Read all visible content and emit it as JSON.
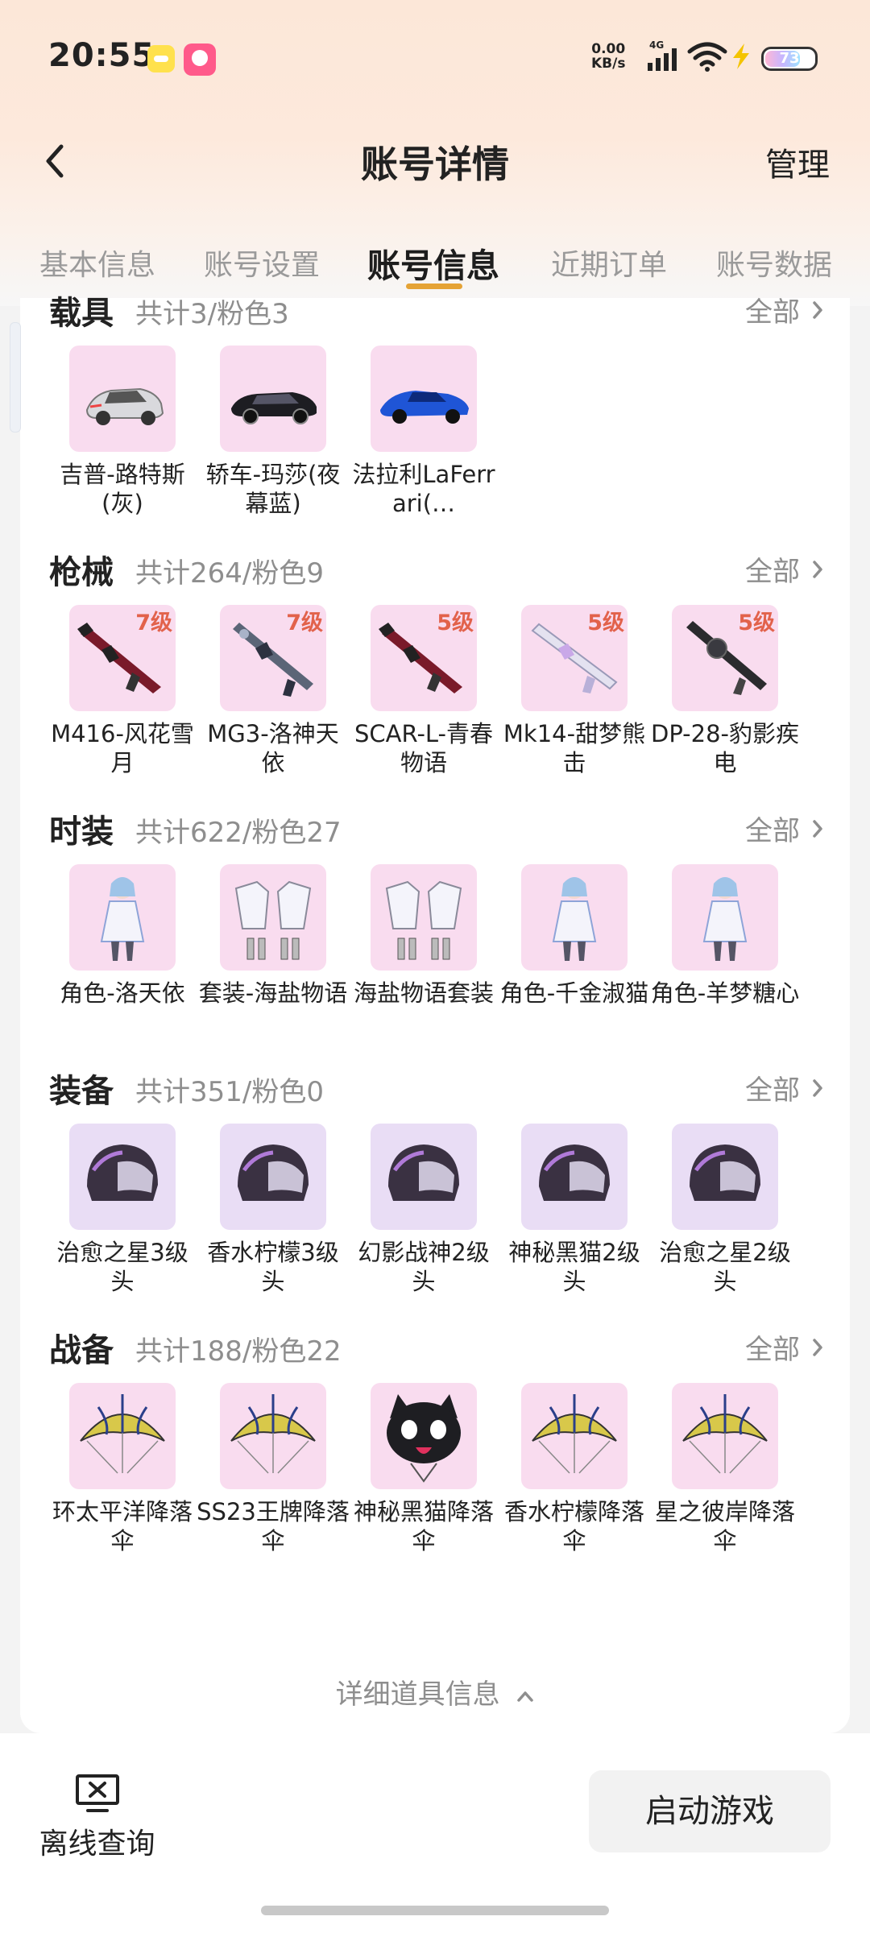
{
  "status_bar": {
    "time": "20:55",
    "net_speed_value": "0.00",
    "net_speed_unit": "KB/s",
    "network_type": "4G",
    "battery_level": "73"
  },
  "nav": {
    "title": "账号详情",
    "manage_label": "管理"
  },
  "tabs": [
    {
      "label": "基本信息",
      "active": false
    },
    {
      "label": "账号设置",
      "active": false
    },
    {
      "label": "账号信息",
      "active": true
    },
    {
      "label": "近期订单",
      "active": false
    },
    {
      "label": "账号数据",
      "active": false
    }
  ],
  "sections": [
    {
      "title": "载具",
      "count": "共计3/粉色3",
      "all_label": "全部",
      "items": [
        {
          "label": "吉普-路特斯(灰)",
          "icon": "gray-suv-icon"
        },
        {
          "label": "轿车-玛莎(夜幕蓝)",
          "icon": "black-sedan-icon"
        },
        {
          "label": "法拉利LaFerrari(…",
          "icon": "blue-supercar-icon"
        }
      ]
    },
    {
      "title": "枪械",
      "count": "共计264/粉色9",
      "all_label": "全部",
      "items": [
        {
          "label": "M416-风花雪月",
          "level": "7级",
          "icon": "rifle-icon"
        },
        {
          "label": "MG3-洛神天依",
          "level": "7级",
          "icon": "machine-gun-icon"
        },
        {
          "label": "SCAR-L-青春物语",
          "level": "5级",
          "icon": "rifle-icon"
        },
        {
          "label": "Mk14-甜梦熊击",
          "level": "5级",
          "icon": "marksman-rifle-icon"
        },
        {
          "label": "DP-28-豹影疾电",
          "level": "5级",
          "icon": "light-machine-gun-icon"
        }
      ]
    },
    {
      "title": "时装",
      "count": "共计622/粉色27",
      "all_label": "全部",
      "items": [
        {
          "label": "角色-洛天依",
          "icon": "character-icon"
        },
        {
          "label": "套装-海盐物语",
          "icon": "outfit-set-icon"
        },
        {
          "label": "海盐物语套装",
          "icon": "outfit-set-icon"
        },
        {
          "label": "角色-千金淑猫",
          "icon": "character-icon"
        },
        {
          "label": "角色-羊梦糖心",
          "icon": "character-icon"
        }
      ]
    },
    {
      "title": "装备",
      "count": "共计351/粉色0",
      "all_label": "全部",
      "items": [
        {
          "label": "治愈之星3级头",
          "icon": "helmet-icon"
        },
        {
          "label": "香水柠檬3级头",
          "icon": "helmet-icon"
        },
        {
          "label": "幻影战神2级头",
          "icon": "helmet-icon"
        },
        {
          "label": "神秘黑猫2级头",
          "icon": "helmet-icon"
        },
        {
          "label": "治愈之星2级头",
          "icon": "helmet-icon"
        }
      ]
    },
    {
      "title": "战备",
      "count": "共计188/粉色22",
      "all_label": "全部",
      "items": [
        {
          "label": "环太平洋降落伞",
          "icon": "parachute-icon"
        },
        {
          "label": "SS23王牌降落伞",
          "icon": "parachute-icon"
        },
        {
          "label": "神秘黑猫降落伞",
          "icon": "cat-parachute-icon"
        },
        {
          "label": "香水柠檬降落伞",
          "icon": "parachute-icon"
        },
        {
          "label": "星之彼岸降落伞",
          "icon": "parachute-icon"
        }
      ]
    }
  ],
  "more_label": "详细道具信息",
  "bottom_bar": {
    "offline_label": "离线查询",
    "launch_label": "启动游戏"
  },
  "colors": {
    "accent": "#e5a335",
    "level_badge": "#e2624b",
    "pink_tile": "#f9dcef",
    "purple_tile": "#e9ddf5"
  }
}
